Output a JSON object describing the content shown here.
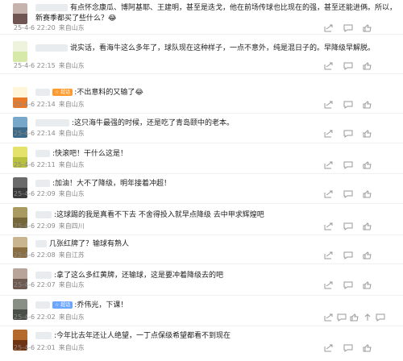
{
  "comments": [
    {
      "id": "c1",
      "has_badge": false,
      "text": "有点怀念康瓜、博阿基耶、王建明，甚至是迭戈，他在前场传球也比现在的强，甚至还能进俩。所以，新赛季都买了些什么？",
      "emoji": "😂",
      "time": "25-4-6 22:20",
      "location": "来自山东",
      "avatar_colors": [
        "#c7b3ad",
        "#6f5652"
      ]
    },
    {
      "id": "c2",
      "has_badge": false,
      "text": "说实话，看海牛这么多年了，球队现在这种样子，一点不意外，纯是混日子的。早降级早解脱。",
      "time": "25-4-6 22:15",
      "location": "来自山东",
      "avatar_colors": [
        "#eef3dd",
        "#d6e9a8"
      ]
    },
    {
      "id": "c3",
      "has_badge": true,
      "badge": "☆ 超话",
      "text": ":不出意料的又输了",
      "emoji": "😂",
      "time": "25-4-6 22:14",
      "location": "来自山东",
      "avatar_colors": [
        "#fff5d9",
        "#e87a2a"
      ]
    },
    {
      "id": "c4",
      "has_badge": false,
      "text": ":这只海牛最强的时候，还是吃了青岛颐中的老本。",
      "time": "25-4-6 22:14",
      "location": "来自山东",
      "avatar_colors": [
        "#77a8c9",
        "#3d6a88"
      ]
    },
    {
      "id": "c5",
      "has_badge": false,
      "text": ":快滚吧！干什么这是！",
      "time": "25-4-6 22:11",
      "location": "来自山东",
      "avatar_colors": [
        "#e4e26a",
        "#b9c03e"
      ]
    },
    {
      "id": "c6",
      "has_badge": false,
      "text": ":加油！大不了降级，明年接着冲超！",
      "time": "25-4-6 22:09",
      "location": "来自山东",
      "avatar_colors": [
        "#6a6a6a",
        "#3c3c3c"
      ]
    },
    {
      "id": "c7",
      "has_badge": false,
      "text": ":这球踢的我是真看不下去 不舍得投入就早点降级 去中甲求辉煌吧",
      "time": "25-4-6 22:09",
      "location": "来自四川",
      "avatar_colors": [
        "#a89a60",
        "#75673a"
      ]
    },
    {
      "id": "c8",
      "has_badge": false,
      "text": "几张红牌了？输球有熟人",
      "time": "25-4-6 22:08",
      "location": "来自江苏",
      "avatar_colors": [
        "#c9b58f",
        "#8b6d42"
      ]
    },
    {
      "id": "c9",
      "has_badge": false,
      "text": ":拿了这么多红黄牌，还输球，这是要冲着降级去的吧",
      "time": "25-4-6 22:07",
      "location": "来自山东",
      "avatar_colors": [
        "#b9a49a",
        "#6e5a50"
      ]
    },
    {
      "id": "c10",
      "has_badge": true,
      "badge": "☆ 超话",
      "text": ":乔伟光，下课！",
      "time": "25-4-6 22:02",
      "location": "来自山东",
      "avatar_colors": [
        "#8a8f86",
        "#4b5148"
      ]
    },
    {
      "id": "c11",
      "has_badge": false,
      "text": ":今年比去年还让人绝望，一丁点保级希望都看不到现在",
      "time": "25-4-6 22:01",
      "location": "来自山东",
      "avatar_colors": [
        "#b46a2c",
        "#6e3414"
      ]
    }
  ]
}
